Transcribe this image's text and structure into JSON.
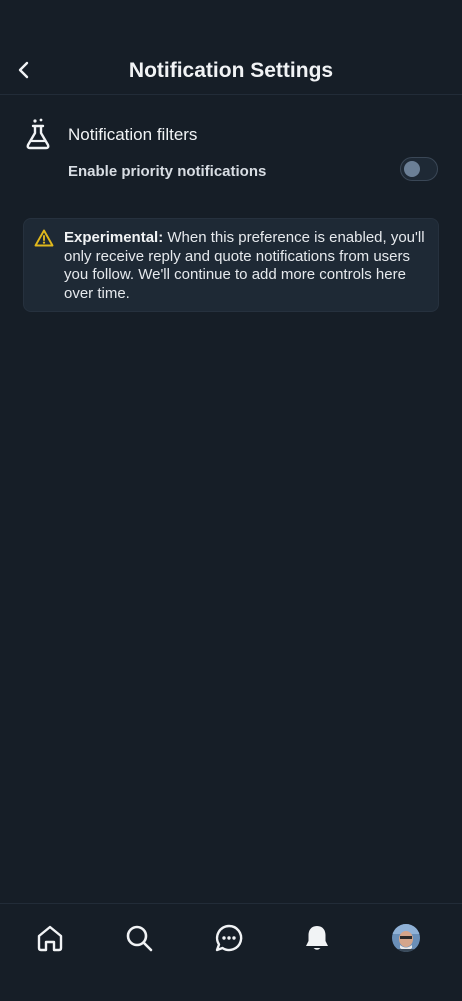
{
  "header": {
    "title": "Notification Settings",
    "back_icon": "chevron-left-icon"
  },
  "filters": {
    "icon": "flask-icon",
    "title": "Notification filters",
    "toggle_label": "Enable priority notifications",
    "toggle_enabled": false
  },
  "notice": {
    "icon": "warning-icon",
    "bold_label": "Experimental:",
    "text": " When this preference is enabled, you'll only receive reply and quote notifications from users you follow. We'll continue to add more controls here over time."
  },
  "bottom_nav": {
    "items": [
      "home-icon",
      "search-icon",
      "chat-icon",
      "bell-icon",
      "avatar"
    ],
    "active": "bell-icon"
  },
  "colors": {
    "background": "#161e27",
    "card": "#1e2935",
    "text": "#f1f3f5",
    "warning": "#e0b81c",
    "toggle_knob": "#6b7f96"
  }
}
